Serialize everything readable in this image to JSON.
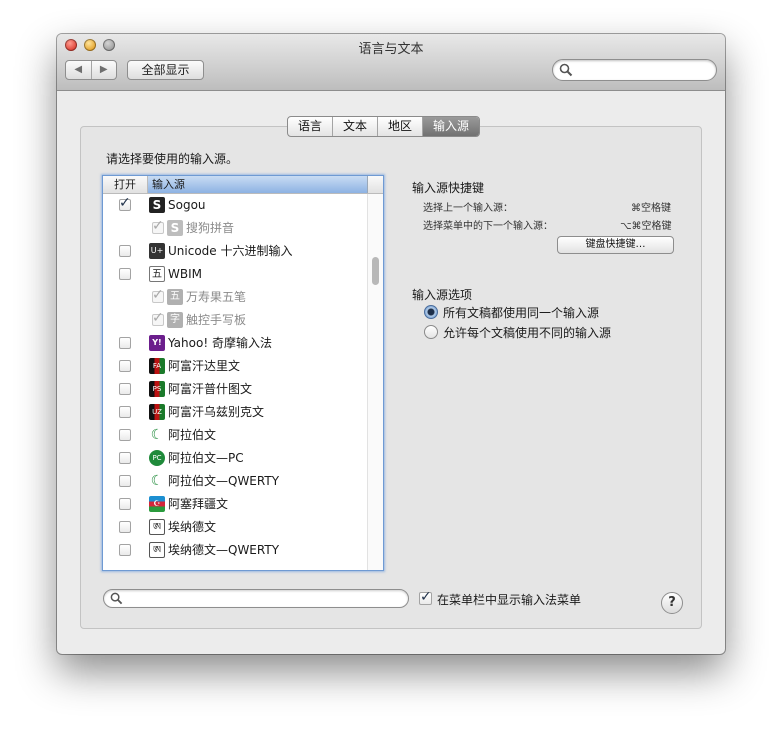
{
  "window": {
    "title": "语言与文本"
  },
  "toolbar": {
    "back_glyph": "◀",
    "forward_glyph": "▶",
    "show_all": "全部显示",
    "search_placeholder": "",
    "search_icon": "magnifier-icon"
  },
  "tabs": [
    {
      "label": "语言",
      "selected": false
    },
    {
      "label": "文本",
      "selected": false
    },
    {
      "label": "地区",
      "selected": false
    },
    {
      "label": "输入源",
      "selected": true
    }
  ],
  "prompt": "请选择要使用的输入源。",
  "list": {
    "col_on": "打开",
    "col_source": "输入源",
    "items": [
      {
        "label": "Sogou",
        "checked": true,
        "icon": "S",
        "icon_name": "sogou-icon",
        "indent": false
      },
      {
        "label": "搜狗拼音",
        "checked": true,
        "icon": "S",
        "icon_name": "sogou-pinyin-icon",
        "indent": true
      },
      {
        "label": "Unicode 十六进制输入",
        "checked": false,
        "icon": "U+",
        "icon_name": "unicode-hex-icon",
        "indent": false
      },
      {
        "label": "WBIM",
        "checked": false,
        "icon": "五",
        "icon_name": "wbim-icon",
        "indent": false
      },
      {
        "label": "万寿果五笔",
        "checked": true,
        "icon": "五",
        "icon_name": "wanshouguo-wubi-icon",
        "indent": true
      },
      {
        "label": "触控手写板",
        "checked": true,
        "icon": "字",
        "icon_name": "trackpad-handwriting-icon",
        "indent": true
      },
      {
        "label": "Yahoo! 奇摩输入法",
        "checked": false,
        "icon": "Y!",
        "icon_name": "yahoo-icon",
        "indent": false
      },
      {
        "label": "阿富汗达里文",
        "checked": false,
        "icon": "FA",
        "icon_name": "afghan-flag-icon",
        "indent": false
      },
      {
        "label": "阿富汗普什图文",
        "checked": false,
        "icon": "PS",
        "icon_name": "afghan-flag-icon",
        "indent": false
      },
      {
        "label": "阿富汗乌兹别克文",
        "checked": false,
        "icon": "UZ",
        "icon_name": "afghan-flag-icon",
        "indent": false
      },
      {
        "label": "阿拉伯文",
        "checked": false,
        "icon": "☾",
        "icon_name": "arabic-crescent-icon",
        "indent": false
      },
      {
        "label": "阿拉伯文—PC",
        "checked": false,
        "icon": "PC",
        "icon_name": "arabic-pc-icon",
        "indent": false
      },
      {
        "label": "阿拉伯文—QWERTY",
        "checked": false,
        "icon": "☾",
        "icon_name": "arabic-qwerty-icon",
        "indent": false
      },
      {
        "label": "阿塞拜疆文",
        "checked": false,
        "icon": "☪",
        "icon_name": "azerbaijan-flag-icon",
        "indent": false
      },
      {
        "label": "埃纳德文",
        "checked": false,
        "icon": "ཨ",
        "icon_name": "ainade-icon",
        "indent": false
      },
      {
        "label": "埃纳德文—QWERTY",
        "checked": false,
        "icon": "ཨ",
        "icon_name": "ainade-qwerty-icon",
        "indent": false
      }
    ]
  },
  "shortcuts": {
    "title": "输入源快捷键",
    "prev_label": "选择上一个输入源：",
    "prev_key": "⌘空格键",
    "next_label": "选择菜单中的下一个输入源：",
    "next_key": "⌥⌘空格键",
    "button": "键盘快捷键…"
  },
  "options": {
    "title": "输入源选项",
    "choices": [
      {
        "label": "所有文稿都使用同一个输入源",
        "selected": true
      },
      {
        "label": "允许每个文稿使用不同的输入源",
        "selected": false
      }
    ]
  },
  "bottom": {
    "search_placeholder": "",
    "show_menu_label": "在菜单栏中显示输入法菜单",
    "show_menu_checked": true,
    "help": "?"
  }
}
